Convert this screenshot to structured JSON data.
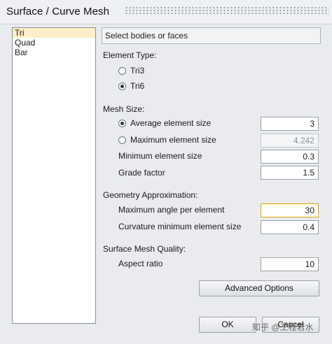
{
  "window": {
    "title": "Surface / Curve Mesh"
  },
  "element_list": {
    "items": [
      {
        "label": "Tri",
        "selected": true
      },
      {
        "label": "Quad",
        "selected": false
      },
      {
        "label": "Bar",
        "selected": false
      }
    ]
  },
  "selection_hint": "Select bodies or faces",
  "element_type": {
    "heading": "Element Type:",
    "options": [
      {
        "label": "Tri3",
        "checked": false
      },
      {
        "label": "Tri6",
        "checked": true
      }
    ]
  },
  "mesh_size": {
    "heading": "Mesh Size:",
    "average": {
      "label": "Average element size",
      "value": "3",
      "checked": true
    },
    "maximum": {
      "label": "Maximum element size",
      "value": "4.242",
      "checked": false
    },
    "minimum": {
      "label": "Minimum element size",
      "value": "0.3"
    },
    "grade": {
      "label": "Grade factor",
      "value": "1.5"
    }
  },
  "geometry": {
    "heading": "Geometry Approximation:",
    "max_angle": {
      "label": "Maximum angle per element",
      "value": "30"
    },
    "curvature_min": {
      "label": "Curvature minimum element size",
      "value": "0.4"
    }
  },
  "quality": {
    "heading": "Surface Mesh Quality:",
    "aspect": {
      "label": "Aspect ratio",
      "value": "10"
    }
  },
  "buttons": {
    "advanced": "Advanced Options",
    "ok": "OK",
    "cancel": "Cancel"
  },
  "watermark": "知乎 @工程若水"
}
